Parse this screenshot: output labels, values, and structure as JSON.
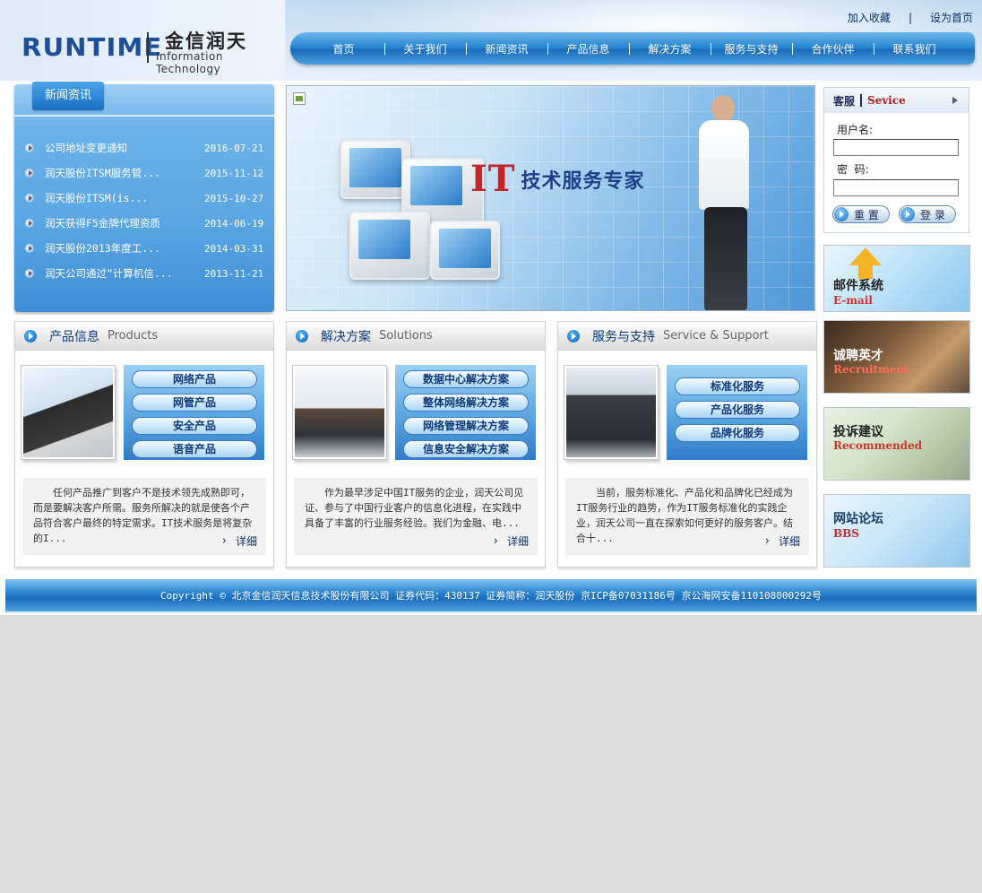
{
  "header": {
    "logo_en": "RUNTIME",
    "logo_cn": "金信润天",
    "logo_sub": "Information Technology",
    "toplinks": {
      "favorite": "加入收藏",
      "separator": "|",
      "homepage": "设为首页"
    },
    "nav": [
      "首页",
      "关于我们",
      "新闻资讯",
      "产品信息",
      "解决方案",
      "服务与支持",
      "合作伙伴",
      "联系我们"
    ]
  },
  "news": {
    "title": "新闻资讯",
    "items": [
      {
        "title": "公司地址变更通知",
        "date": "2016-07-21"
      },
      {
        "title": "润天股份ITSM服务管...",
        "date": "2015-11-12"
      },
      {
        "title": "润天股份ITSM(is...",
        "date": "2015-10-27"
      },
      {
        "title": "润天获得F5金牌代理资质",
        "date": "2014-06-19"
      },
      {
        "title": "润天股份2013年度工...",
        "date": "2014-03-31"
      },
      {
        "title": "润天公司通过“计算机信...",
        "date": "2013-11-21"
      }
    ]
  },
  "banner": {
    "slogan_it": "IT",
    "slogan_cn": "技术服务专家"
  },
  "login": {
    "title_cn": "客服",
    "title_en": "Sevice",
    "username_label": "用户名:",
    "password_label": "密  码:",
    "reset_label": "重 置",
    "login_label": "登 录"
  },
  "tiles": {
    "mail": {
      "cn": "邮件系统",
      "en": "E-mail"
    },
    "recruit": {
      "cn": "诚聘英才",
      "en": "Recruitment"
    },
    "advice": {
      "cn": "投诉建议",
      "en": "Recommended"
    },
    "bbs": {
      "cn": "网站论坛",
      "en": "BBS"
    }
  },
  "panels": {
    "products": {
      "title_cn": "产品信息",
      "title_en": "Products",
      "menu": [
        "网络产品",
        "网管产品",
        "安全产品",
        "语音产品"
      ],
      "desc": "任何产品推广到客户不是技术领先成熟即可，而是要解决客户所需。服务所解决的就是使各个产品符合客户最终的特定需求。IT技术服务是将复杂的I...",
      "more": "详细"
    },
    "solutions": {
      "title_cn": "解决方案",
      "title_en": "Solutions",
      "menu": [
        "数据中心解决方案",
        "整体网络解决方案",
        "网络管理解决方案",
        "信息安全解决方案"
      ],
      "desc": "作为最早涉足中国IT服务的企业，润天公司见证、参与了中国行业客户的信息化进程，在实践中具备了丰富的行业服务经验。我们为金融、电...",
      "more": "详细"
    },
    "service": {
      "title_cn": "服务与支持",
      "title_en": "Service & Support",
      "menu": [
        "标准化服务",
        "产品化服务",
        "品牌化服务"
      ],
      "desc": "当前，服务标准化、产品化和品牌化已经成为IT服务行业的趋势，作为IT服务标准化的实践企业，润天公司一直在探索如何更好的服务客户。结合十...",
      "more": "详细"
    }
  },
  "footer": {
    "text": "Copyright © 北京金信润天信息技术股份有限公司 证券代码：430137 证券简称：润天股份   京ICP备07031186号   京公海网安备110108000292号"
  },
  "colors": {
    "nav_blue": "#2a86d1",
    "link_dark": "#0d2f6b",
    "red_accent": "#c0262c"
  }
}
